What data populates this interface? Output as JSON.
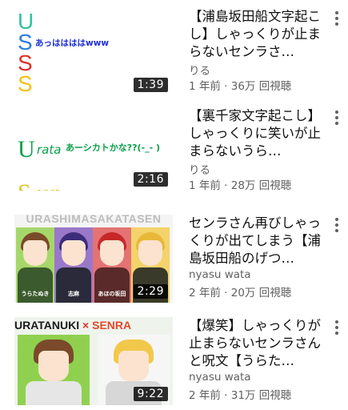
{
  "colors": {
    "accent_green": "#8fd14f",
    "text_secondary": "#606060"
  },
  "videos": [
    {
      "title": "【浦島坂田船文字起こし】しゃっくりが止まらないセンラさ…",
      "channel": "りる",
      "meta": "1 年前 · 36万 回視聴",
      "duration": "1:39",
      "thumb_text": {
        "letters": [
          "U",
          "S",
          "S",
          "S"
        ],
        "caption": "あっははははwww"
      }
    },
    {
      "title": "【裏千家文字起こし】しゃっくりに笑いが止まらないうら…",
      "channel": "りる",
      "meta": "1 年前 · 28万 回視聴",
      "duration": "2:16",
      "thumb_text": {
        "ura": "U",
        "rata": "rata",
        "caption": "あーシカトかな??(-_- )",
        "senra_s": "S",
        "senra_rest": "enra"
      }
    },
    {
      "title": "センラさん再びしゃっくりが出てしまう【浦島坂田船のげつ…",
      "channel": "nyasu wata",
      "meta": "2 年前 · 20万 回視聴",
      "duration": "2:29",
      "thumb_text": {
        "banner": "URASHIMASAKATASEN",
        "names": [
          "うらたぬき",
          "志麻",
          "あほの坂田",
          ""
        ]
      }
    },
    {
      "title": "【爆笑】しゃっくりが止まらないセンラさんと呪文【うらた…",
      "channel": "nyasu wata",
      "meta": "2 年前 · 31万 回視聴",
      "duration": "9:22",
      "thumb_text": {
        "left": "URATANUKI",
        "x": "×",
        "right": "SENRA"
      }
    }
  ]
}
